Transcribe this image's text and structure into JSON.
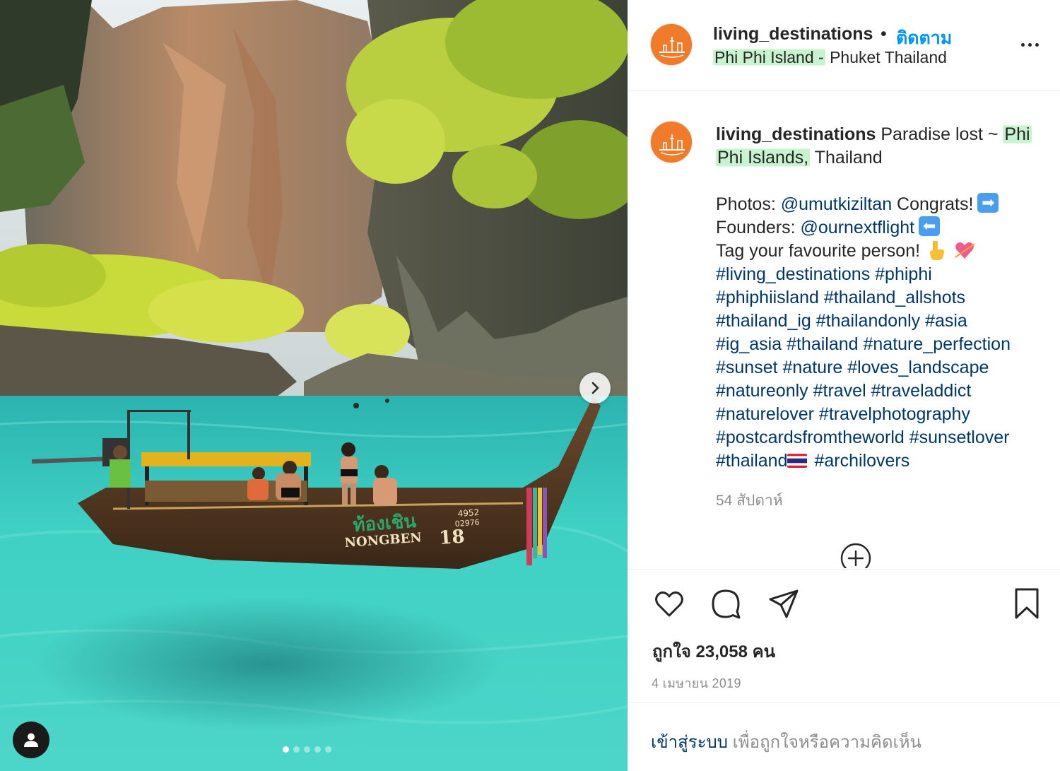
{
  "post": {
    "username": "living_destinations",
    "separator": "•",
    "follow_label": "ติดตาม",
    "location_highlight": "Phi Phi Island -",
    "location_rest": " Phuket Thailand",
    "more_label": "More options"
  },
  "photo": {
    "boat_text_thai": "ท้องเชิน",
    "boat_name": "NONGBEN",
    "boat_number": "18",
    "boat_reg_top": "4952",
    "boat_reg_bottom": "02976",
    "carousel_count": 5,
    "carousel_active": 1
  },
  "caption": {
    "username": "living_destinations",
    "text_start": " Paradise lost ~ ",
    "place_highlight_1": "Phi",
    "place_highlight_2": "Phi Islands,",
    "text_end": " Thailand",
    "photos_label": "Photos: ",
    "photos_mention": "@umutkiziltan",
    "photos_tail": " Congrats!",
    "founders_label": "Founders: ",
    "founders_mention": "@ournextflight",
    "tag_line": "Tag your favourite person!",
    "hashtag_lines": [
      "#living_destinations #phiphi",
      "#phiphiisland #thailand_allshots",
      "#thailand_ig #thailandonly #asia",
      "#ig_asia #thailand #nature_perfection",
      "#sunset #nature #loves_landscape",
      "#natureonly #travel #traveladdict",
      "#naturelover #travelphotography",
      "#postcardsfromtheworld #sunsetlover"
    ],
    "last_tag_1": "#thailand",
    "last_tag_2": "#archilovers",
    "time_ago": "54 สัปดาห์"
  },
  "engagement": {
    "likes": "ถูกใจ 23,058 คน",
    "date": "4 เมษายน 2019"
  },
  "footer": {
    "login_link": "เข้าสู่ระบบ",
    "login_rest": " เพื่อถูกใจหรือความคิดเห็น"
  },
  "colors": {
    "link_blue": "#0095f6",
    "hashtag_blue": "#00376b",
    "avatar_orange": "#f07b2a",
    "highlight_green": "#c8f3cf",
    "muted_gray": "#8e8e8e"
  },
  "icons": [
    "chevron-right-icon",
    "user-tag-icon",
    "more-horizontal-icon",
    "heart-icon",
    "comment-icon",
    "share-icon",
    "bookmark-icon",
    "plus-circle-icon"
  ]
}
